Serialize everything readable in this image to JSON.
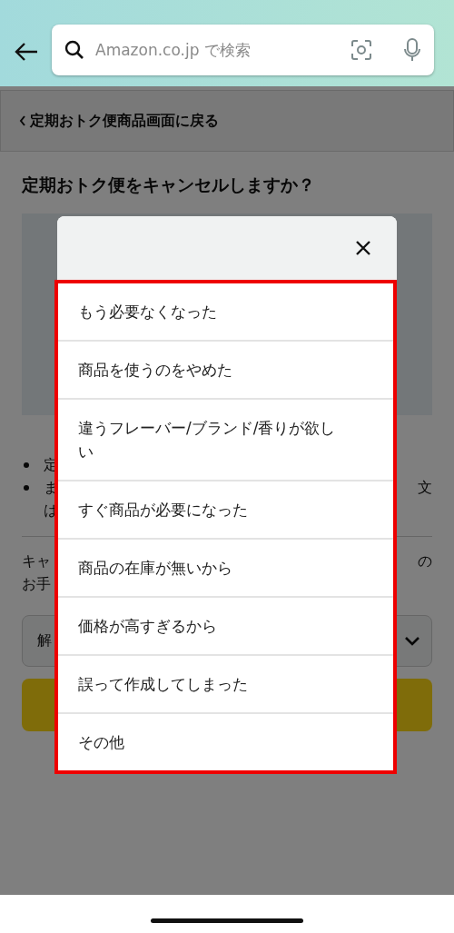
{
  "header": {
    "search": {
      "placeholder": "Amazon.co.jp で検索"
    }
  },
  "page": {
    "back_link": "定期おトク便商品画面に戻る",
    "title": "定期おトク便をキャンセルしますか？",
    "bullets": [
      {
        "kind": "bullet",
        "left": "定"
      },
      {
        "kind": "bullet",
        "left": "ま",
        "right": "文"
      },
      {
        "kind": "continuation",
        "left": "は"
      }
    ],
    "paragraph": [
      {
        "left": "キャ",
        "right": "の"
      },
      {
        "left": "お手"
      }
    ],
    "dropdown": {
      "value": "解"
    }
  },
  "modal": {
    "options": [
      {
        "label": "もう必要なくなった"
      },
      {
        "label": "商品を使うのをやめた"
      },
      {
        "label": "違うフレーバー/ブランド/香りが欲しい"
      },
      {
        "label": "すぐ商品が必要になった"
      },
      {
        "label": "商品の在庫が無いから"
      },
      {
        "label": "価格が高すぎるから"
      },
      {
        "label": "誤って作成してしまった"
      },
      {
        "label": "その他"
      }
    ],
    "highlighted": true
  }
}
